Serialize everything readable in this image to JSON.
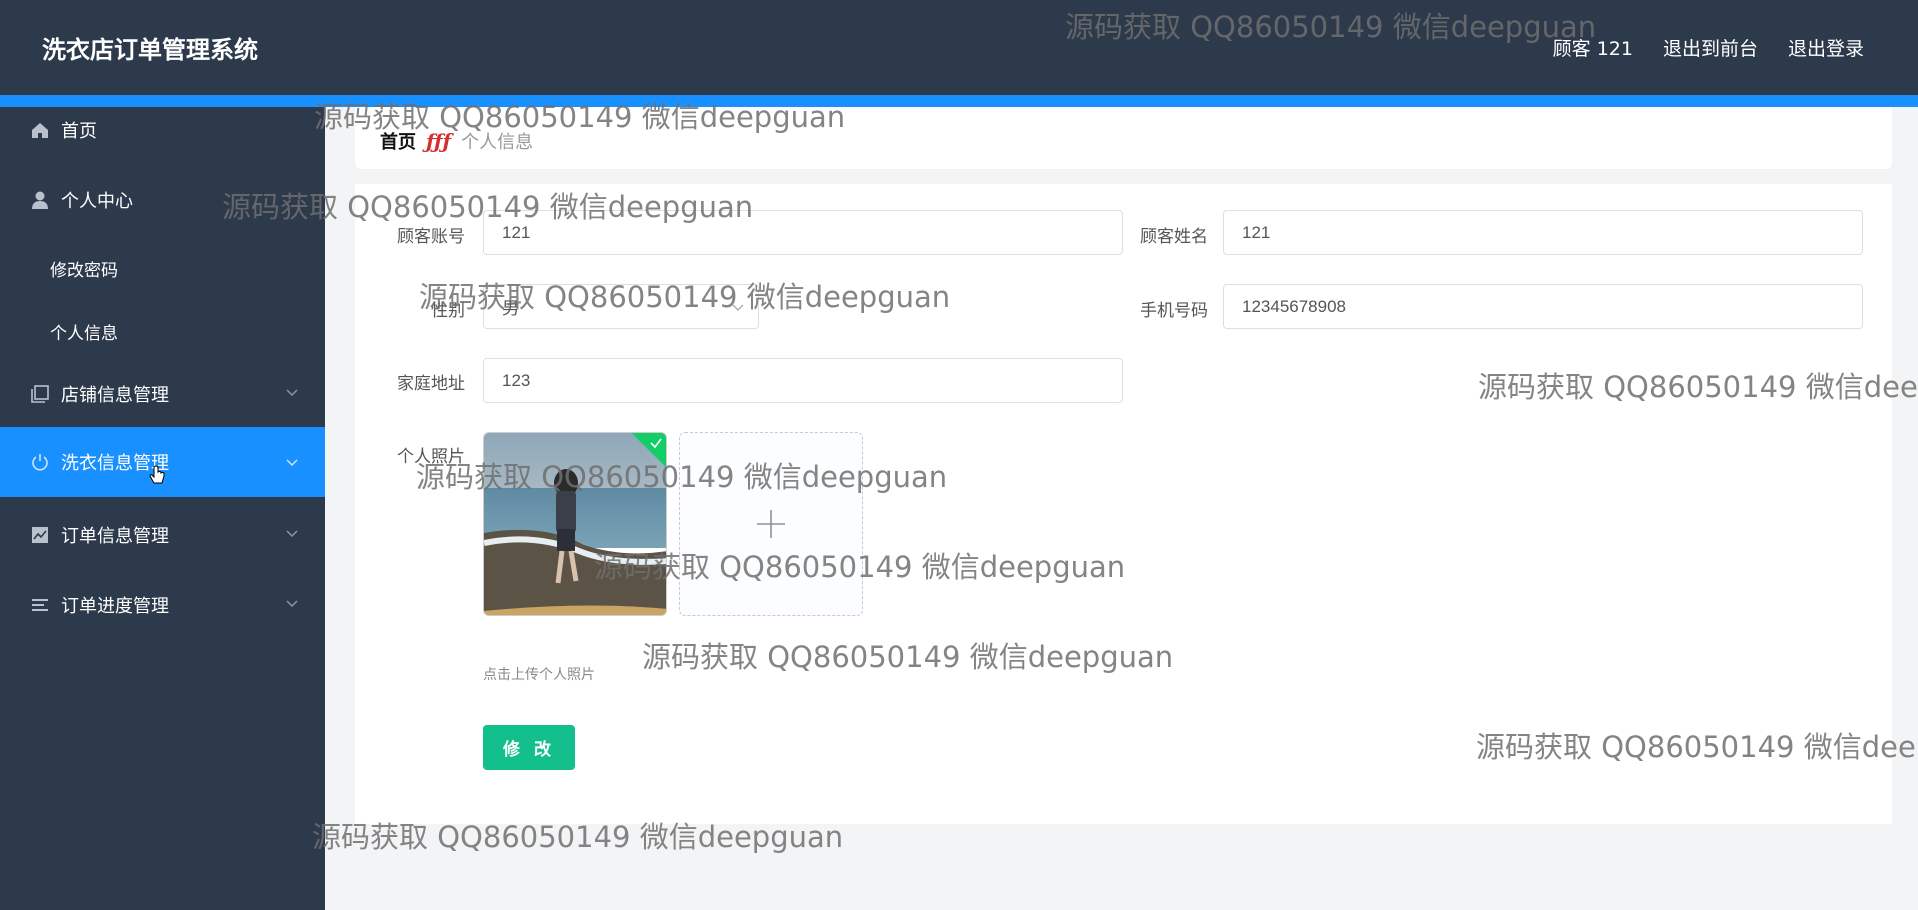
{
  "header": {
    "title": "洗衣店订单管理系统",
    "user": "顾客 121",
    "to_front": "退出到前台",
    "logout": "退出登录"
  },
  "sidebar": {
    "items": [
      {
        "label": "首页",
        "icon": "home-icon"
      },
      {
        "label": "个人中心",
        "icon": "user-icon"
      },
      {
        "label": "店铺信息管理",
        "icon": "copy-icon"
      },
      {
        "label": "洗衣信息管理",
        "icon": "power-icon"
      },
      {
        "label": "订单信息管理",
        "icon": "chart-icon"
      },
      {
        "label": "订单进度管理",
        "icon": "list-icon"
      }
    ],
    "sub_items": [
      "修改密码",
      "个人信息"
    ],
    "active_color": "#1890ff"
  },
  "breadcrumb": {
    "home": "首页",
    "separator": "ƒƒƒ",
    "current": "个人信息"
  },
  "form": {
    "account_label": "顾客账号",
    "account_value": "121",
    "name_label": "顾客姓名",
    "name_value": "121",
    "gender_label": "性别",
    "gender_value": "男",
    "phone_label": "手机号码",
    "phone_value": "12345678908",
    "address_label": "家庭地址",
    "address_value": "123",
    "photo_label": "个人照片",
    "upload_tip": "点击上传个人照片",
    "submit_label": "修 改"
  },
  "watermark": "源码获取 QQ86050149 微信deepguan"
}
